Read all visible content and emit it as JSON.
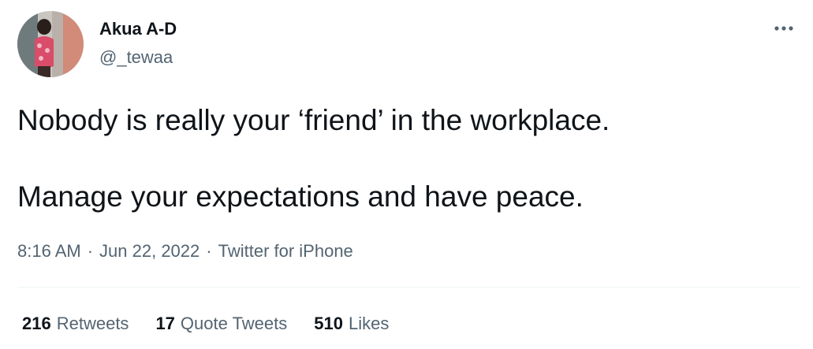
{
  "author": {
    "display_name": "Akua A-D",
    "handle": "@_tewaa",
    "avatar_icon": "profile-photo"
  },
  "more_icon": "more-horizontal-icon",
  "tweet": {
    "lines": [
      "Nobody is really your ‘friend’ in the workplace.",
      "Manage your expectations and have peace."
    ]
  },
  "meta": {
    "time": "8:16 AM",
    "separator": "·",
    "date": "Jun 22, 2022",
    "source": "Twitter for iPhone"
  },
  "stats": [
    {
      "count": "216",
      "label": "Retweets"
    },
    {
      "count": "17",
      "label": "Quote Tweets"
    },
    {
      "count": "510",
      "label": "Likes"
    }
  ],
  "colors": {
    "text_primary": "#0f1419",
    "text_secondary": "#536471",
    "divider": "#eff3f4"
  }
}
